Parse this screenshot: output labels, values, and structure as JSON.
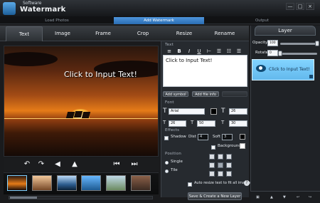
{
  "app": {
    "brand_small": "Software",
    "brand": "Watermark"
  },
  "steps": {
    "load": "Load Photos",
    "add": "Add Watermark",
    "output": "Output"
  },
  "tabs": [
    "Text",
    "Image",
    "Frame",
    "Crop",
    "Resize",
    "Rename"
  ],
  "preview": {
    "text": "Click to Input Text!"
  },
  "editor": {
    "text": "Click to Input Text!",
    "add_symbol": "Add symbol",
    "add_file_info": "Add file info",
    "font": "Arial",
    "size": "26",
    "spacing": "26",
    "width": "50",
    "height": "30",
    "shadow": "Shadow",
    "dist": "Dist",
    "dist_value": "4",
    "soft": "Soft",
    "soft_value": "3",
    "background": "Background",
    "single": "Single",
    "tile": "Tile",
    "auto_resize": "Auto resize text to fit all images",
    "save_button": "Save & Create a New Layer"
  },
  "layer": {
    "title": "Layer",
    "opacity_label": "Opacity",
    "opacity_value": "100",
    "opacity_level": 1.0,
    "rotate_label": "Rotate",
    "rotate_value": "0",
    "rotate_level": 0.0,
    "item_text": "Click to Input Text!"
  }
}
